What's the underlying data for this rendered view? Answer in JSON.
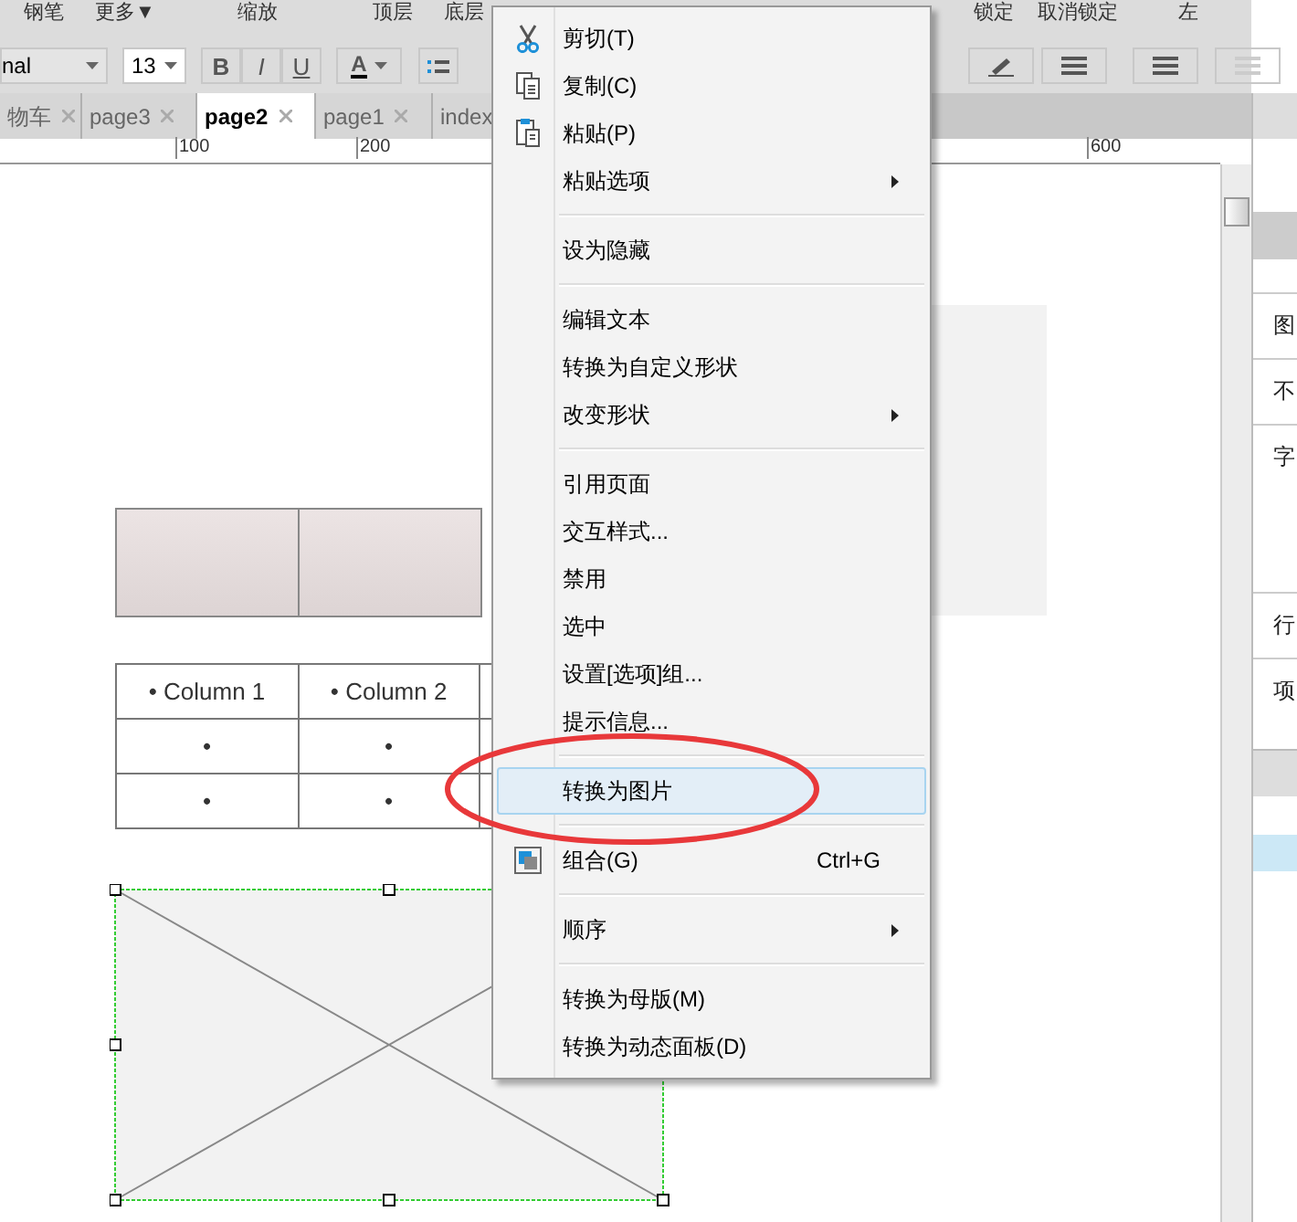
{
  "toolbar_top": [
    "钢笔",
    "更多▼",
    "缩放",
    "顶层",
    "底层",
    "锁定",
    "取消锁定",
    "左"
  ],
  "format_bar": {
    "font": "nal",
    "size": "13",
    "bold": "B",
    "italic": "I",
    "underline": "U",
    "color_letter": "A"
  },
  "tabs": [
    {
      "label": "物车",
      "selected": false
    },
    {
      "label": "page3",
      "selected": false
    },
    {
      "label": "page2",
      "selected": true
    },
    {
      "label": "page1",
      "selected": false
    },
    {
      "label": "index",
      "selected": false
    }
  ],
  "ruler": [
    "100",
    "200",
    "600"
  ],
  "table": {
    "header": [
      "• Column 1",
      "• Column 2"
    ],
    "rows": [
      [
        "•",
        "•"
      ],
      [
        "•",
        "•"
      ]
    ]
  },
  "right_panel": [
    "图",
    "不",
    "字",
    "行",
    "项"
  ],
  "context_menu": [
    {
      "kind": "cut",
      "label": "剪切(T)",
      "selected": false
    },
    {
      "kind": "copy",
      "label": "复制(C)",
      "selected": false
    },
    {
      "kind": "paste",
      "label": "粘贴(P)",
      "selected": false
    },
    {
      "kind": "submenu",
      "label": "粘贴选项",
      "selected": false
    },
    {
      "kind": "separator"
    },
    {
      "kind": "plain",
      "label": "设为隐藏",
      "selected": false
    },
    {
      "kind": "separator"
    },
    {
      "kind": "plain",
      "label": "编辑文本",
      "selected": false
    },
    {
      "kind": "plain",
      "label": "转换为自定义形状",
      "selected": false
    },
    {
      "kind": "submenu",
      "label": "改变形状",
      "selected": false
    },
    {
      "kind": "separator"
    },
    {
      "kind": "plain",
      "label": "引用页面",
      "selected": false
    },
    {
      "kind": "plain",
      "label": "交互样式...",
      "selected": false
    },
    {
      "kind": "plain",
      "label": "禁用",
      "selected": false
    },
    {
      "kind": "plain",
      "label": "选中",
      "selected": false
    },
    {
      "kind": "plain",
      "label": "设置[选项]组...",
      "selected": false
    },
    {
      "kind": "plain",
      "label": "提示信息...",
      "selected": false
    },
    {
      "kind": "separator"
    },
    {
      "kind": "plain",
      "label": "转换为图片",
      "selected": true
    },
    {
      "kind": "separator"
    },
    {
      "kind": "group",
      "label": "组合(G)",
      "shortcut": "Ctrl+G",
      "selected": false
    },
    {
      "kind": "separator"
    },
    {
      "kind": "submenu",
      "label": "顺序",
      "selected": false
    },
    {
      "kind": "separator"
    },
    {
      "kind": "plain",
      "label": "转换为母版(M)",
      "selected": false
    },
    {
      "kind": "plain",
      "label": "转换为动态面板(D)",
      "selected": false
    }
  ]
}
